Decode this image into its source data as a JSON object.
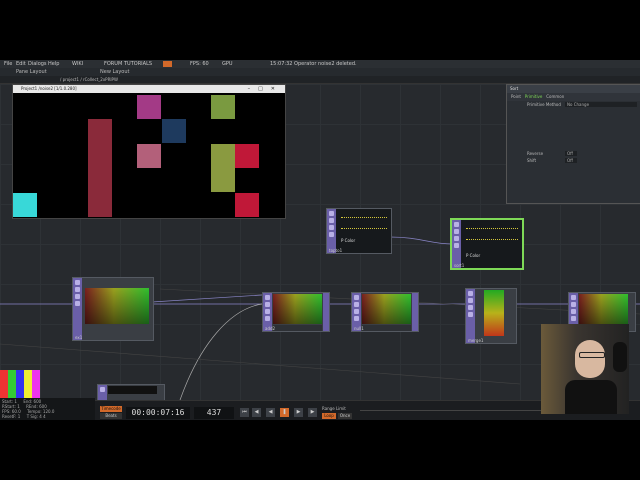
{
  "menubar": {
    "items": [
      "File",
      "Edit",
      "Dialogs",
      "Help"
    ],
    "links": [
      "WIKI",
      "FORUM",
      "TUTORIALS"
    ],
    "fps": "FPS: 60",
    "gpu": "GPU",
    "status": "15:07:32 Operator noise2 deleted."
  },
  "tabs": {
    "pane_layout": "Pane Layout",
    "new_layout": "New Layout"
  },
  "pathbar": {
    "path": "/ project1 / rCollect_2xPRIPW"
  },
  "window": {
    "title": "Project1 /noise2 [1/1.0.280]"
  },
  "panel": {
    "title": "Sort",
    "tabs": [
      "Point",
      "Primitive",
      "Common"
    ],
    "primitive_method_label": "Primitive Method",
    "primitive_method_value": "No Change",
    "reverse_label": "Reverse",
    "reverse_value": "Off",
    "shift_label": "Shift",
    "shift_value": "Off"
  },
  "nodes": {
    "ex": "ex1",
    "add": "add2",
    "null": "null1",
    "copy": "topto1",
    "sort": "sort1",
    "merge": "merge1",
    "chop_label": "P Color"
  },
  "timebar": {
    "timecode_label": "Timecode",
    "beats_label": "Beats",
    "timecode": "00:00:07:16",
    "frame": "437",
    "range_label": "Range Limit",
    "loop": "Loop",
    "once": "Once"
  },
  "stats": {
    "rows": [
      {
        "k": "Start:",
        "v": "1",
        "k2": "End:",
        "v2": "600"
      },
      {
        "k": "RStart:",
        "v": "1",
        "k2": "REnd:",
        "v2": "600"
      },
      {
        "k": "FPS:",
        "v": "60.0",
        "k2": "Tempo:",
        "v2": "120.0"
      },
      {
        "k": "ResetF:",
        "v": "1",
        "k2": "T Sig:",
        "v2": "4    4"
      }
    ]
  },
  "colors": {
    "accent_green": "#7ed957",
    "node_purple": "#6a5fa8",
    "timecode_orange": "#d2692a"
  }
}
